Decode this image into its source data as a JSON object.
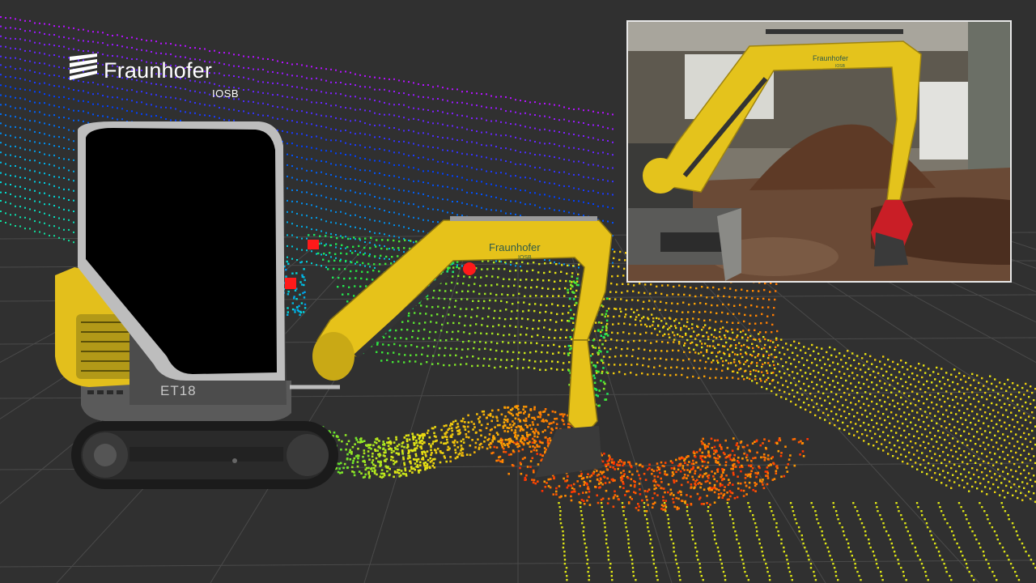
{
  "logo": {
    "brand": "Fraunhofer",
    "institute": "IOSB"
  },
  "machine": {
    "model_label": "ET18",
    "boom_brand": "Fraunhofer",
    "boom_sub": "IOSB"
  },
  "inset_photo": {
    "boom_brand": "Fraunhofer",
    "boom_sub": "IOSB"
  },
  "colors": {
    "background": "#303030",
    "grid": "#4a4a4a",
    "excavator_yellow": "#e6c21a",
    "marker_red": "#ff1a1a"
  }
}
